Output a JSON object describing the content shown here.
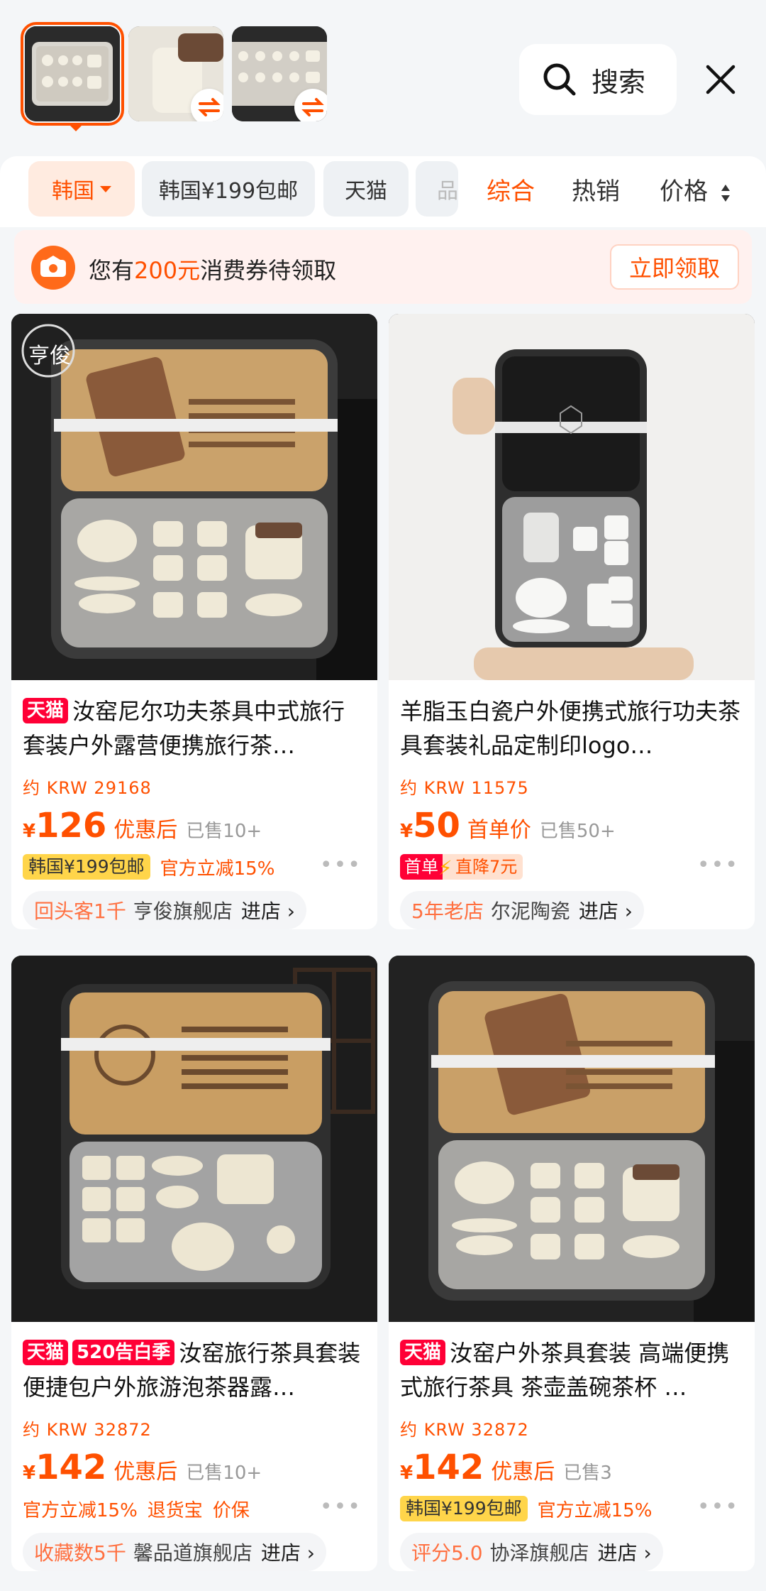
{
  "header": {
    "search_label": "搜索",
    "icons": {
      "search": "search-icon",
      "close": "close-icon",
      "swap": "swap-icon"
    }
  },
  "filters": {
    "chips": [
      {
        "label": "韩国",
        "active": true
      },
      {
        "label": "韩国¥199包邮"
      },
      {
        "label": "天猫"
      },
      {
        "label": "品"
      }
    ],
    "sort_tabs": [
      {
        "label": "综合",
        "active": true
      },
      {
        "label": "热销"
      },
      {
        "label": "价格"
      }
    ]
  },
  "coupon": {
    "prefix": "您有",
    "amount": "200元",
    "suffix": "消费券待领取",
    "button": "立即领取"
  },
  "products": [
    {
      "tags": [
        "天猫"
      ],
      "title": "汝窑尼尔功夫茶具中式旅行套装户外露营便携旅行茶…",
      "krw": "约 KRW 29168",
      "yen": "¥",
      "price": "126",
      "price_note": "优惠后",
      "sold": "已售10+",
      "promo_yellow": "韩国¥199包邮",
      "promo_texts": [
        "官方立减15%"
      ],
      "store_highlight": "回头客1千",
      "store_name": "亨俊旗舰店",
      "store_enter": "进店 ›",
      "logo_text": "亨俊"
    },
    {
      "tags": [],
      "title": "羊脂玉白瓷户外便携式旅行功夫茶具套装礼品定制印logo…",
      "krw": "约 KRW 11575",
      "yen": "¥",
      "price": "50",
      "price_note": "首单价",
      "sold": "已售50+",
      "shoudan_a": "首单",
      "shoudan_b": "直降7元",
      "store_highlight": "5年老店",
      "store_name": "尔泥陶瓷",
      "store_enter": "进店 ›"
    },
    {
      "tags": [
        "天猫",
        "520告白季"
      ],
      "title": "汝窑旅行茶具套装便捷包户外旅游泡茶器露…",
      "krw": "约 KRW 32872",
      "yen": "¥",
      "price": "142",
      "price_note": "优惠后",
      "sold": "已售10+",
      "promo_texts": [
        "官方立减15%",
        "退货宝",
        "价保"
      ],
      "store_highlight": "收藏数5千",
      "store_name": "馨品道旗舰店",
      "store_enter": "进店 ›"
    },
    {
      "tags": [
        "天猫"
      ],
      "title": "汝窑户外茶具套装 高端便携式旅行茶具 茶壶盖碗茶杯 …",
      "krw": "约 KRW 32872",
      "yen": "¥",
      "price": "142",
      "price_note": "优惠后",
      "sold": "已售3",
      "promo_yellow": "韩国¥199包邮",
      "promo_texts": [
        "官方立减15%"
      ],
      "store_highlight": "评分5.0",
      "store_name": "协泽旗舰店",
      "store_enter": "进店 ›"
    }
  ],
  "more_dots": "•••"
}
